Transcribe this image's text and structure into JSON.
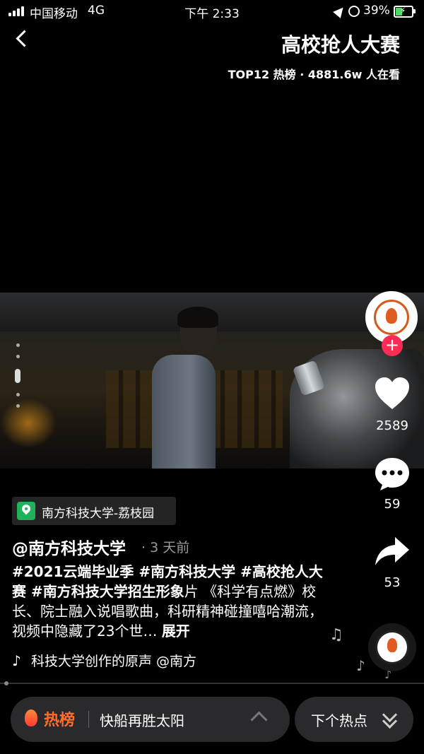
{
  "status_bar": {
    "carrier": "中国移动",
    "network": "4G",
    "time": "下午 2:33",
    "battery": "39%"
  },
  "header": {
    "title": "高校抢人大赛",
    "subtitle": "TOP12 热榜 ·  4881.6w 人在看"
  },
  "location": {
    "label": "南方科技大学-荔枝园"
  },
  "post": {
    "author": "@南方科技大学",
    "time": "· 3 天前",
    "caption_tags": "#2021云端毕业季  #南方科技大学  #高校抢人大赛  #南方科技大学招生形象",
    "caption_body": "片 《科学有点燃》校长、院士融入说唱歌曲，科研精神碰撞嘻哈潮流，视频中隐藏了23个世…",
    "expand_label": "展开",
    "music": "科技大学创作的原声    @南方"
  },
  "actions": {
    "likes": "2589",
    "comments": "59",
    "shares": "53",
    "follow": "+"
  },
  "avatar": {
    "text": "南方科技大学"
  },
  "bottom_bar": {
    "hot_label": "热榜",
    "hot_topic": "快船再胜太阳",
    "next_label": "下个热点"
  },
  "colors": {
    "accent": "#fe2c55",
    "hot": "#ff6d2e",
    "location_pin": "#20b25a"
  }
}
